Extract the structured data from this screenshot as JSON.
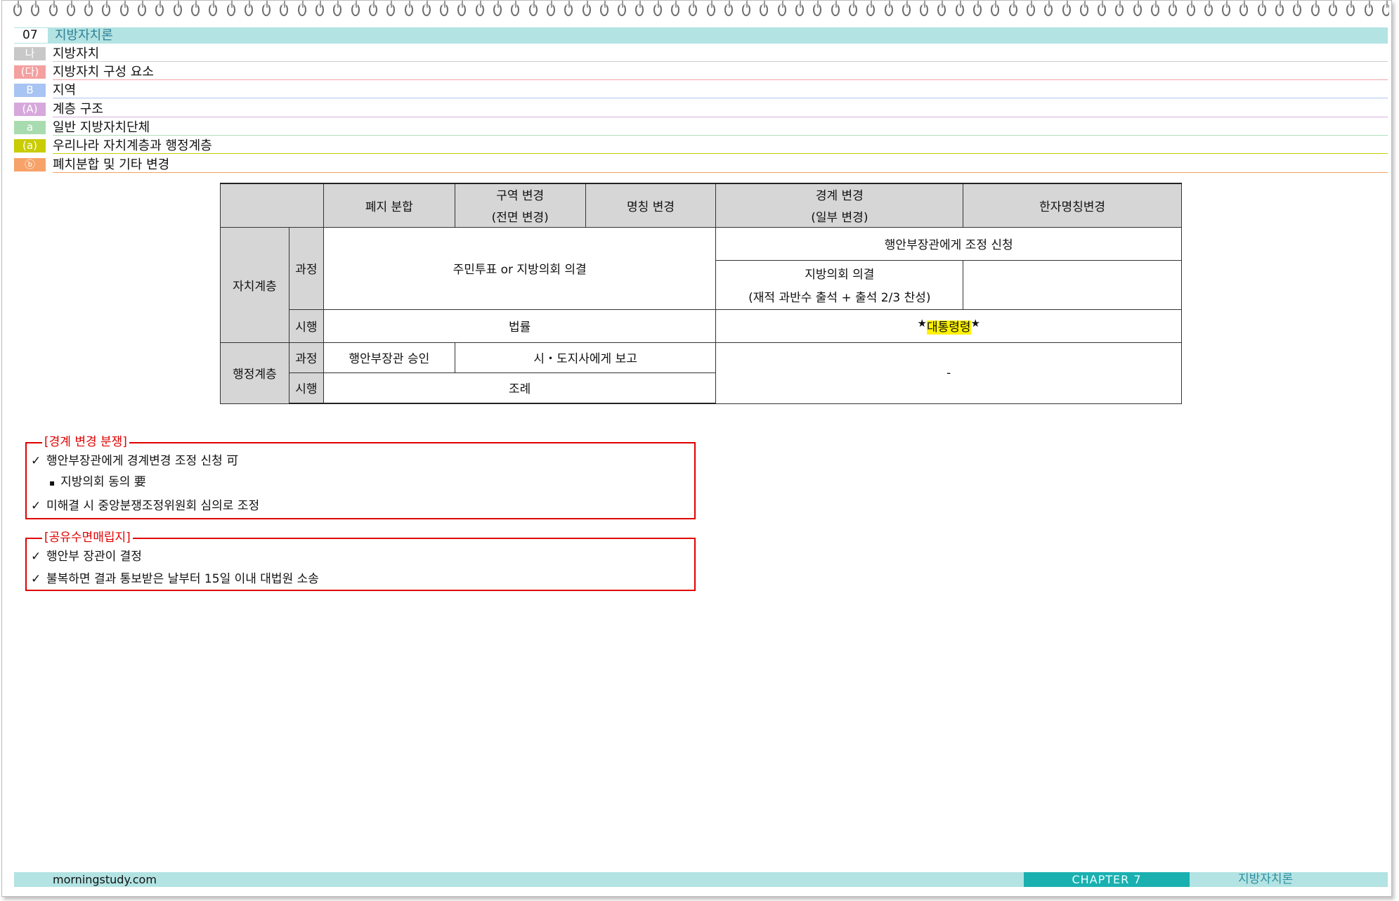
{
  "chapter": {
    "number": "07",
    "title": "지방자치론"
  },
  "outline": [
    {
      "tag": "나",
      "text": "지방자치",
      "tag_color": "#c8c8c8",
      "line_color": "#cfcfcf"
    },
    {
      "tag": "(다)",
      "text": "지방자치 구성 요소",
      "tag_color": "#f4a0a0",
      "line_color": "#f2a6a6"
    },
    {
      "tag": "B",
      "text": "지역",
      "tag_color": "#a8c4f2",
      "line_color": "#aec6ee"
    },
    {
      "tag": "(A)",
      "text": "계층 구조",
      "tag_color": "#d6a8dc",
      "line_color": "#d7b0dc"
    },
    {
      "tag": "a",
      "text": "일반 지방자치단체",
      "tag_color": "#a8dcb0",
      "line_color": "#b2ddb8"
    },
    {
      "tag": "(a)",
      "text": "우리나라 자치계층과 행정계층",
      "tag_color": "#c8cc00",
      "line_color": "#c8cc00"
    },
    {
      "tag": "ⓑ",
      "text": "폐치분합 및 기타 변경",
      "tag_color": "#f7a268",
      "line_color": "#f5a060"
    }
  ],
  "table": {
    "headers": {
      "merge": "폐지 분합",
      "district_1": "구역 변경",
      "district_2": "(전면 변경)",
      "name": "명칭 변경",
      "boundary_1": "경계 변경",
      "boundary_2": "(일부 변경)",
      "hanja": "한자명칭변경"
    },
    "self_gov": {
      "label": "자치계층",
      "process": "과정",
      "process_left": "주민투표 or 지방의회 의결",
      "process_right_top": "행안부장관에게 조정 신청",
      "process_right_mid_1": "지방의회 의결",
      "process_right_mid_2": "(재적 과반수 출석 + 출석 2/3 찬성)",
      "enforce": "시행",
      "enforce_left": "법률",
      "enforce_right": "대통령령",
      "star": "★"
    },
    "admin": {
      "label": "행정계층",
      "process": "과정",
      "process_a": "행안부장관 승인",
      "process_b": "시・도지사에게 보고",
      "enforce": "시행",
      "enforce_left": "조례",
      "right": "-"
    }
  },
  "notes": [
    {
      "title": "[경계 변경 분쟁]",
      "items": [
        "행안부장관에게 경계변경 조정 신청 可",
        "지방의회 동의 要",
        "미해결 시 중앙분쟁조정위원회 심의로 조정"
      ]
    },
    {
      "title": "[공유수면매립지]",
      "items": [
        "행안부 장관이 결정",
        "불복하면 결과 통보받은 날부터 15일 이내 대법원 소송"
      ]
    }
  ],
  "check": "✓",
  "bullet": "▪",
  "footer": {
    "site": "morningstudy.com",
    "chapter": "CHAPTER 7",
    "title": "지방자치론"
  }
}
